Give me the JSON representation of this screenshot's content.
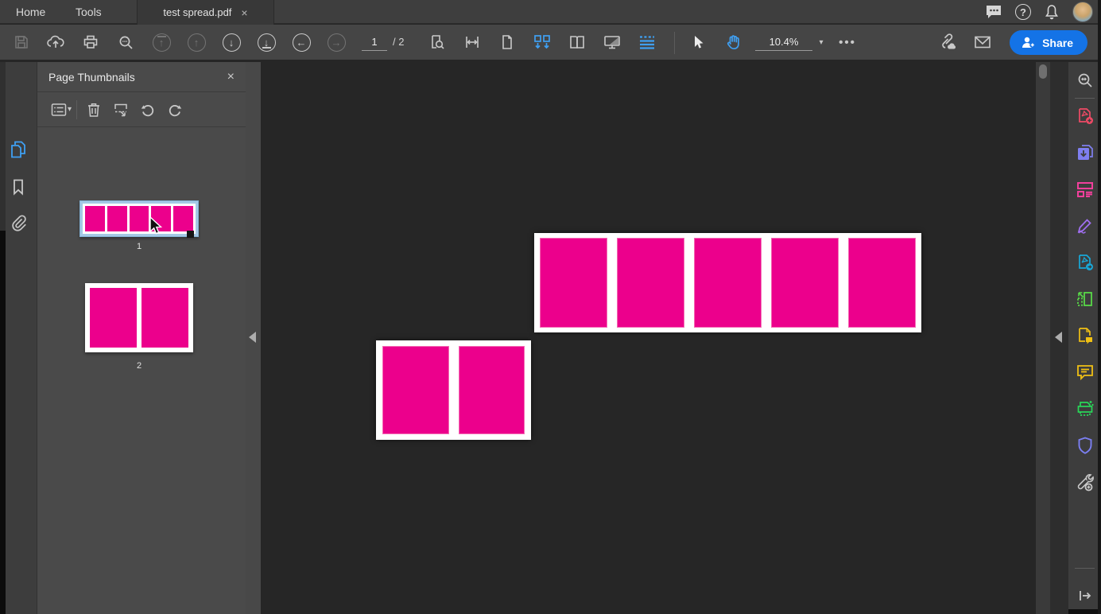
{
  "tabbar": {
    "home": "Home",
    "tools": "Tools",
    "document_title": "test spread.pdf"
  },
  "toolbar": {
    "page_number": "1",
    "page_total": "/ 2",
    "zoom_level": "10.4%",
    "share_label": "Share"
  },
  "panel": {
    "title": "Page Thumbnails"
  },
  "pages": [
    {
      "label": "1",
      "rects": 5,
      "selected": true
    },
    {
      "label": "2",
      "rects": 2,
      "selected": false
    }
  ],
  "glyphs": {
    "close": "×",
    "caret_down": "▾",
    "ellipsis": "•••",
    "help": "?",
    "arrow_up": "↑",
    "arrow_down": "↓",
    "arrow_left": "←",
    "arrow_right": "→",
    "rotate_ccw": "↺",
    "rotate_cw": "↻"
  },
  "colors": {
    "accent_blue": "#3fa0f3",
    "share_blue": "#1473e6",
    "page_pink": "#ec008c",
    "selection_blue": "#a5c9e5",
    "create_pdf_red": "#f04a66",
    "combine_purple": "#7f7ff0",
    "edit_pink": "#f23f9c",
    "fill_sign_purple": "#a06ff0",
    "export_teal": "#18a8d8",
    "crop_green": "#58d848",
    "comment_yellow": "#f0c014",
    "scan_green": "#28d858",
    "shield_purple": "#7b7ff2"
  }
}
